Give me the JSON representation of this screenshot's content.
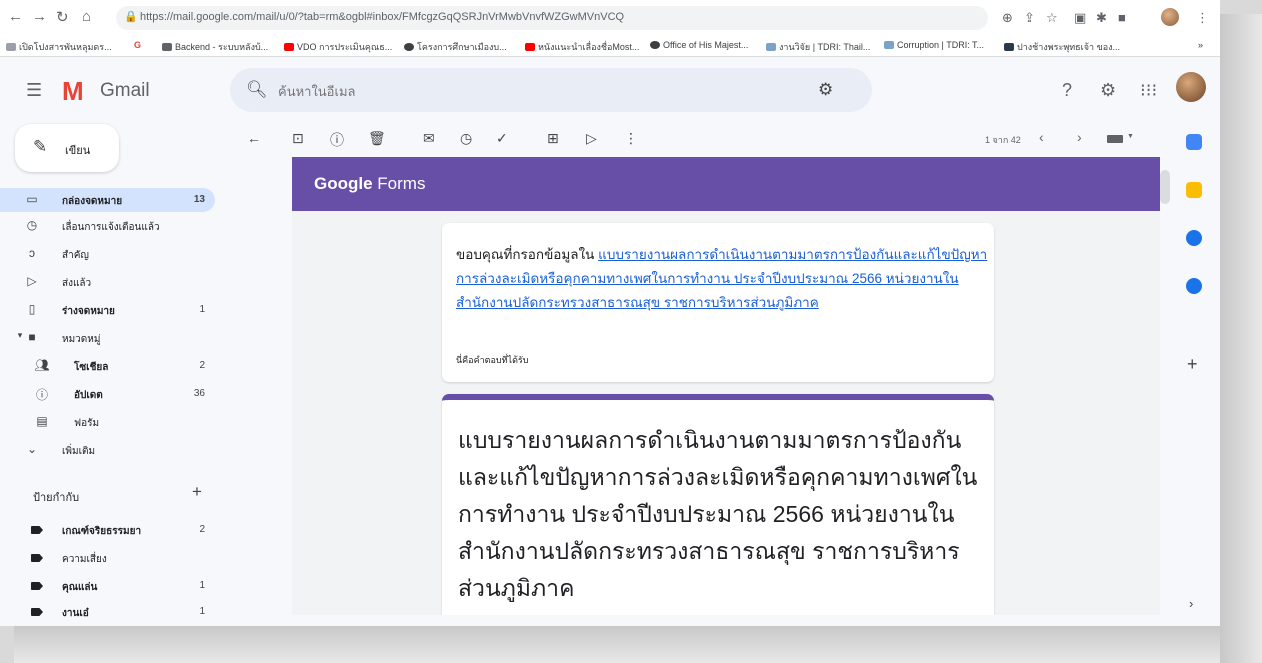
{
  "browser": {
    "url": "https://mail.google.com/mail/u/0/?tab=rm&ogbl#inbox/FMfcgzGqQSRJnVrMwbVnvfWZGwMVnVCQ",
    "bookmarks": [
      "เปิดโปงสารพันหลุมดร...",
      "Backend - ระบบหลังบ้...",
      "VDO การประเมินคุณธ...",
      "โครงการศึกษาเมืองบ...",
      "หนังแนะนำเลื่องชื่อMost...",
      "Office of His Majest...",
      "งานวิจัย | TDRI: Thail...",
      "Corruption | TDRI: T...",
      "ปางช้างพระพุทธเจ้า ของ..."
    ]
  },
  "gmail": {
    "logo_text": "Gmail",
    "search_placeholder": "ค้นหาในอีเมล",
    "compose_label": "เขียน"
  },
  "sidebar": {
    "items": [
      {
        "label": "กล่องจดหมาย",
        "count": "13",
        "icon": "inbox-icon"
      },
      {
        "label": "เลื่อนการแจ้งเตือนแล้ว",
        "count": "",
        "icon": "clock-icon"
      },
      {
        "label": "สำคัญ",
        "count": "",
        "icon": "important-icon"
      },
      {
        "label": "ส่งแล้ว",
        "count": "",
        "icon": "send-icon"
      },
      {
        "label": "ร่างจดหมาย",
        "count": "1",
        "icon": "draft-icon"
      },
      {
        "label": "หมวดหมู่",
        "count": "",
        "icon": "category-icon"
      },
      {
        "label": "โซเชียล",
        "count": "2",
        "icon": "social-icon"
      },
      {
        "label": "อัปเดต",
        "count": "36",
        "icon": "info-icon"
      },
      {
        "label": "ฟอรัม",
        "count": "",
        "icon": "forum-icon"
      },
      {
        "label": "เพิ่มเติม",
        "count": "",
        "icon": "chevron-down-icon"
      }
    ],
    "labels_title": "ป้ายกำกับ",
    "labels": [
      {
        "label": "เกณฑ์จริยธรรมยา",
        "count": "2"
      },
      {
        "label": "ความเสี่ยง",
        "count": ""
      },
      {
        "label": "คุณแล่น",
        "count": "1"
      },
      {
        "label": "งานเอ๋",
        "count": "1"
      }
    ]
  },
  "toolbar": {
    "pager_text": "1 จาก 42"
  },
  "email": {
    "banner_google": "Google",
    "banner_forms": "Forms",
    "thanks_prefix": "ขอบคุณที่กรอกข้อมูลใน ",
    "form_link": "แบบรายงานผลการดำเนินงานตามมาตรการป้องกันและแก้ไขปัญหาการล่วงละเมิดหรือคุกคามทางเพศในการทำงาน ประจำปีงบประมาณ 2566 หน่วยงานในสำนักงานปลัดกระทรวงสาธารณสุข ราชการบริหารส่วนภูมิภาค",
    "receipt_note": "นี่คือคำตอบที่ได้รับ",
    "form_title": "แบบรายงานผลการดำเนินงานตามมาตรการป้องกันและแก้ไขปัญหาการล่วงละเมิดหรือคุกคามทางเพศในการทำงาน ประจำปีงบประมาณ 2566 หน่วยงานในสำนักงานปลัดกระทรวงสาธารณสุข ราชการบริหารส่วนภูมิภาค"
  },
  "colors": {
    "forms_purple": "#674ea7",
    "link_blue": "#1a5fd8",
    "active_nav": "#d3e3fd"
  }
}
